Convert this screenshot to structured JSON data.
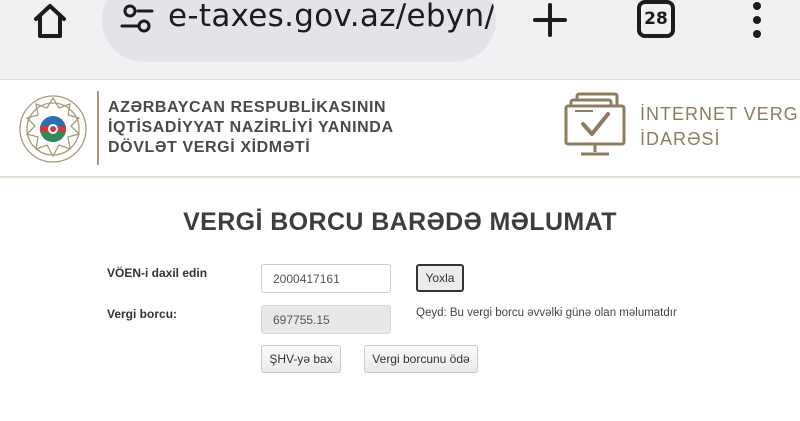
{
  "browser": {
    "url": "e-taxes.gov.az/ebyn/",
    "tab_count": "28"
  },
  "header": {
    "org_lines": [
      "AZƏRBAYCAN RESPUBLİKASININ",
      "İQTİSADİYYAT NAZİRLİYİ YANINDA",
      "DÖVLƏT VERGİ XİDMƏTİ"
    ],
    "ivi_lines": [
      "İNTERNET VERGİ",
      "İDARƏSİ"
    ]
  },
  "main": {
    "title": "VERGİ BORCU BARƏDƏ MƏLUMAT",
    "voen_label": "VÖEN-i daxil edin",
    "voen_value": "2000417161",
    "check_button": "Yoxla",
    "debt_label": "Vergi borcu:",
    "debt_value": "697755.15",
    "note": "Qeyd: Bu vergi borcu əvvəlki günə olan məlumatdır",
    "shv_button": "ŞHV-yə bax",
    "pay_button": "Vergi borcunu ödə"
  },
  "colors": {
    "gold": "#8c7e5c",
    "emblem_green": "#2e8b57",
    "emblem_blue": "#2a6fb5",
    "emblem_red": "#d23a3a"
  }
}
